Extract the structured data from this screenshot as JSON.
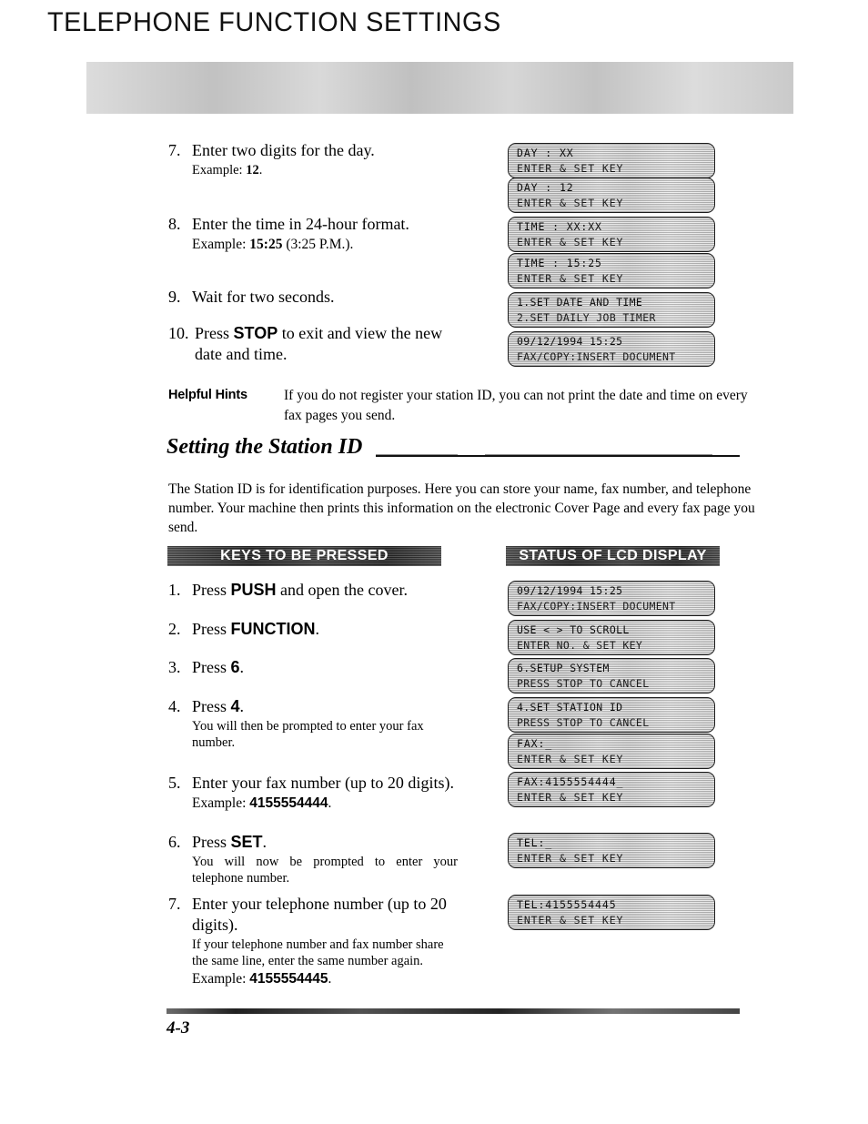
{
  "header": {
    "title": "TELEPHONE FUNCTION SETTINGS"
  },
  "top_steps": [
    {
      "num": "7.",
      "text": "Enter two digits for the day.",
      "sub_prefix": "Example: ",
      "sub_bold": "12",
      "sub_suffix": "."
    },
    {
      "num": "8.",
      "text": "Enter the time in 24-hour format.",
      "sub_prefix": "Example: ",
      "sub_bold": "15:25",
      "sub_suffix": " (3:25 P.M.)."
    },
    {
      "num": "9.",
      "text": "Wait for two seconds."
    },
    {
      "num": "10.",
      "text_pre": "Press ",
      "text_bold": "STOP",
      "text_post": " to exit and view the new date and time."
    }
  ],
  "top_lcds": [
    {
      "line1": "DAY : XX",
      "line2": "ENTER & SET KEY"
    },
    {
      "line1": "DAY : 12",
      "line2": "ENTER & SET KEY"
    },
    {
      "line1": "TIME : XX:XX",
      "line2": "ENTER & SET KEY"
    },
    {
      "line1": "TIME : 15:25",
      "line2": "ENTER & SET KEY"
    },
    {
      "line1": "1.SET DATE AND TIME",
      "line2": "2.SET DAILY JOB TIMER"
    },
    {
      "line1": "09/12/1994 15:25",
      "line2": "FAX/COPY:INSERT DOCUMENT"
    }
  ],
  "hints": {
    "label": "Helpful Hints",
    "text": "If you do not register your station ID, you can not print the date and time on every fax pages you send."
  },
  "section": {
    "heading": "Setting the Station ID",
    "intro": "The Station ID is for identification purposes. Here you can store your name, fax number, and telephone number. Your machine then prints this information on the electronic Cover Page and every fax page you send."
  },
  "banners": {
    "keys": "KEYS TO BE PRESSED",
    "status": "STATUS OF LCD DISPLAY"
  },
  "main_steps": [
    {
      "num": "1.",
      "pre": "Press ",
      "bold": "PUSH",
      "post": " and open the cover."
    },
    {
      "num": "2.",
      "pre": "Press ",
      "bold": "FUNCTION",
      "post": "."
    },
    {
      "num": "3.",
      "pre": "Press ",
      "bold": "6",
      "post": "."
    },
    {
      "num": "4.",
      "pre": "Press ",
      "bold": "4",
      "post": ".",
      "note": "You will then be prompted to enter your fax number."
    },
    {
      "num": "5.",
      "pre": "Enter your fax number (up to 20 digits).",
      "example_prefix": "Example: ",
      "example_bold": "4155554444",
      "example_suffix": "."
    },
    {
      "num": "6.",
      "pre": "Press ",
      "bold": "SET",
      "post": ".",
      "note": "You will now be prompted to enter your telephone number."
    },
    {
      "num": "7.",
      "pre": "Enter your telephone number (up to 20 digits).",
      "note": "If your telephone number and fax number share the same line, enter the same number again.",
      "example_prefix": "Example: ",
      "example_bold": "4155554445",
      "example_suffix": "."
    }
  ],
  "main_lcds": [
    {
      "line1": "09/12/1994 15:25",
      "line2": "FAX/COPY:INSERT DOCUMENT"
    },
    {
      "line1": "USE < > TO SCROLL",
      "line2": "ENTER NO. & SET KEY"
    },
    {
      "line1": "6.SETUP SYSTEM",
      "line2": "PRESS STOP TO CANCEL"
    },
    {
      "line1": "4.SET STATION ID",
      "line2": "PRESS STOP TO CANCEL"
    },
    {
      "line1": "FAX:_",
      "line2": "ENTER & SET KEY"
    },
    {
      "line1": "FAX:4155554444_",
      "line2": "ENTER & SET KEY"
    },
    {
      "line1": "TEL:_",
      "line2": "ENTER & SET KEY"
    },
    {
      "line1": "TEL:4155554445",
      "line2": "ENTER & SET KEY"
    }
  ],
  "footer": {
    "page_number": "4-3"
  },
  "colors": {
    "header_band": "#b9b9b9",
    "banner_dark": "#353535",
    "lcd_fill": "#d2d2d2",
    "ink": "#000000"
  }
}
